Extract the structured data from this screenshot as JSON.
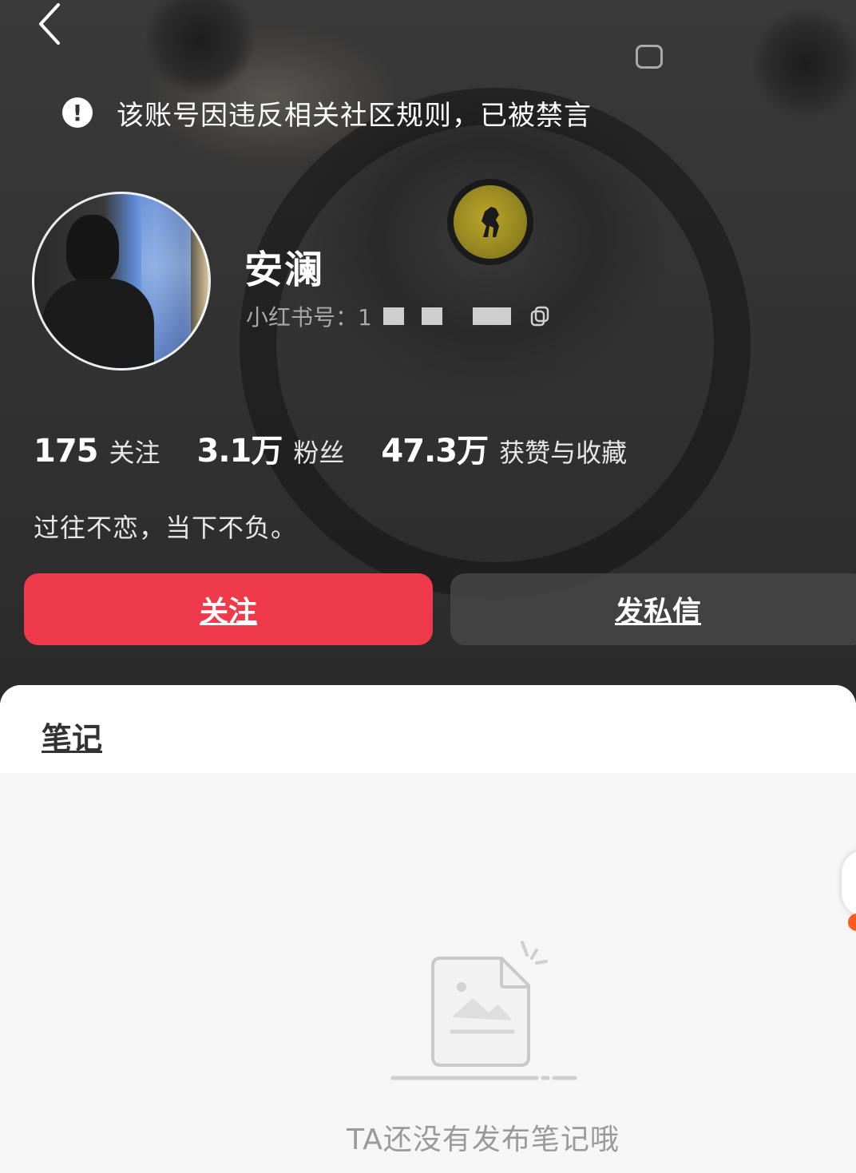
{
  "header": {
    "ban_notice": "该账号因违反相关社区规则，已被禁言"
  },
  "profile": {
    "nickname": "安澜",
    "id_label": "小红书号：1",
    "stats": [
      {
        "number": "175",
        "label": "关注"
      },
      {
        "number": "3.1万",
        "label": "粉丝"
      },
      {
        "number": "47.3万",
        "label": "获赞与收藏"
      }
    ],
    "bio": "过往不恋，当下不负。"
  },
  "actions": {
    "follow_label": "关注",
    "message_label": "发私信"
  },
  "tabs": {
    "notes_label": "笔记"
  },
  "empty_state": {
    "text": "TA还没有发布笔记哦"
  },
  "colors": {
    "accent": "#ee3a4a",
    "header_bg": "#2f2f2f",
    "panel_bg": "#f6f6f6"
  }
}
